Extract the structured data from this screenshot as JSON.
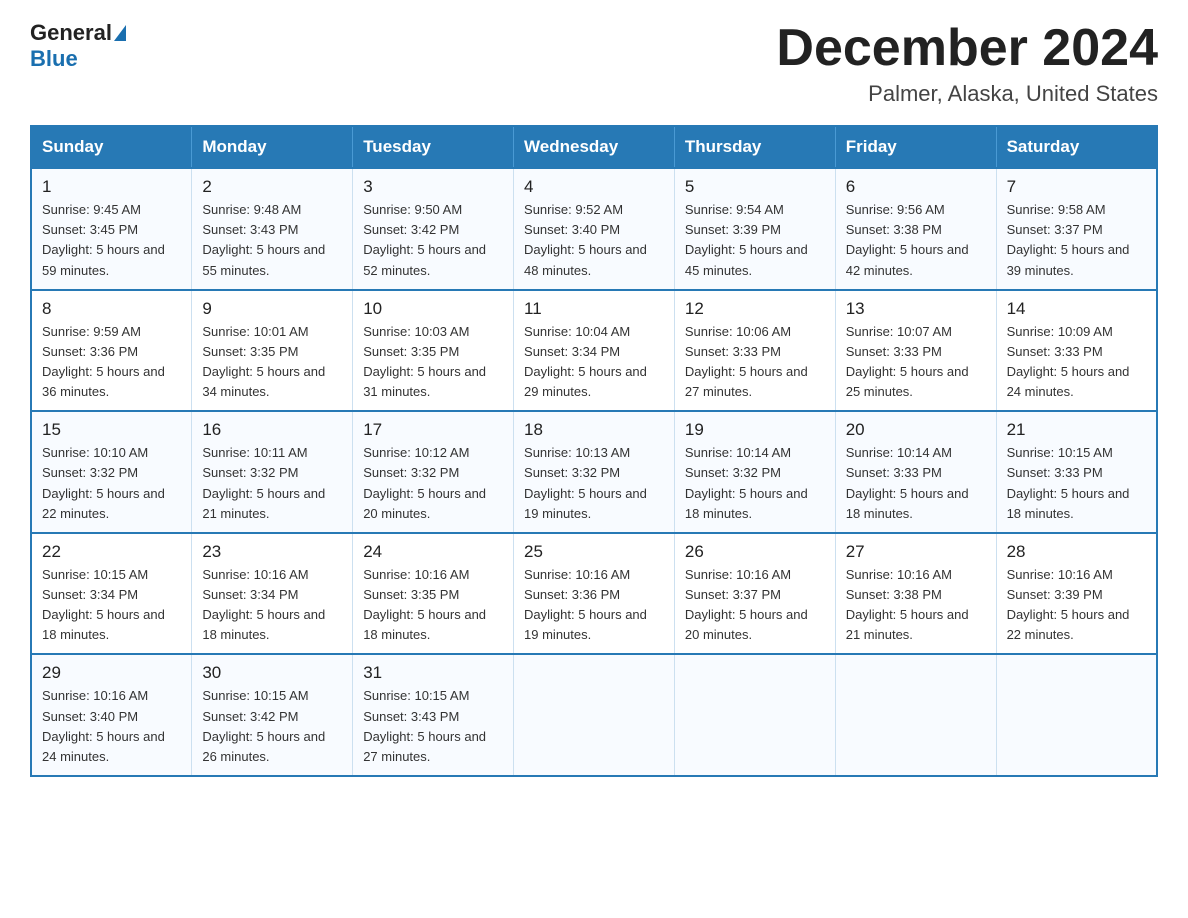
{
  "header": {
    "logo_general": "General",
    "logo_blue": "Blue",
    "month_title": "December 2024",
    "location": "Palmer, Alaska, United States"
  },
  "weekdays": [
    "Sunday",
    "Monday",
    "Tuesday",
    "Wednesday",
    "Thursday",
    "Friday",
    "Saturday"
  ],
  "weeks": [
    [
      {
        "day": "1",
        "sunrise": "9:45 AM",
        "sunset": "3:45 PM",
        "daylight": "5 hours and 59 minutes."
      },
      {
        "day": "2",
        "sunrise": "9:48 AM",
        "sunset": "3:43 PM",
        "daylight": "5 hours and 55 minutes."
      },
      {
        "day": "3",
        "sunrise": "9:50 AM",
        "sunset": "3:42 PM",
        "daylight": "5 hours and 52 minutes."
      },
      {
        "day": "4",
        "sunrise": "9:52 AM",
        "sunset": "3:40 PM",
        "daylight": "5 hours and 48 minutes."
      },
      {
        "day": "5",
        "sunrise": "9:54 AM",
        "sunset": "3:39 PM",
        "daylight": "5 hours and 45 minutes."
      },
      {
        "day": "6",
        "sunrise": "9:56 AM",
        "sunset": "3:38 PM",
        "daylight": "5 hours and 42 minutes."
      },
      {
        "day": "7",
        "sunrise": "9:58 AM",
        "sunset": "3:37 PM",
        "daylight": "5 hours and 39 minutes."
      }
    ],
    [
      {
        "day": "8",
        "sunrise": "9:59 AM",
        "sunset": "3:36 PM",
        "daylight": "5 hours and 36 minutes."
      },
      {
        "day": "9",
        "sunrise": "10:01 AM",
        "sunset": "3:35 PM",
        "daylight": "5 hours and 34 minutes."
      },
      {
        "day": "10",
        "sunrise": "10:03 AM",
        "sunset": "3:35 PM",
        "daylight": "5 hours and 31 minutes."
      },
      {
        "day": "11",
        "sunrise": "10:04 AM",
        "sunset": "3:34 PM",
        "daylight": "5 hours and 29 minutes."
      },
      {
        "day": "12",
        "sunrise": "10:06 AM",
        "sunset": "3:33 PM",
        "daylight": "5 hours and 27 minutes."
      },
      {
        "day": "13",
        "sunrise": "10:07 AM",
        "sunset": "3:33 PM",
        "daylight": "5 hours and 25 minutes."
      },
      {
        "day": "14",
        "sunrise": "10:09 AM",
        "sunset": "3:33 PM",
        "daylight": "5 hours and 24 minutes."
      }
    ],
    [
      {
        "day": "15",
        "sunrise": "10:10 AM",
        "sunset": "3:32 PM",
        "daylight": "5 hours and 22 minutes."
      },
      {
        "day": "16",
        "sunrise": "10:11 AM",
        "sunset": "3:32 PM",
        "daylight": "5 hours and 21 minutes."
      },
      {
        "day": "17",
        "sunrise": "10:12 AM",
        "sunset": "3:32 PM",
        "daylight": "5 hours and 20 minutes."
      },
      {
        "day": "18",
        "sunrise": "10:13 AM",
        "sunset": "3:32 PM",
        "daylight": "5 hours and 19 minutes."
      },
      {
        "day": "19",
        "sunrise": "10:14 AM",
        "sunset": "3:32 PM",
        "daylight": "5 hours and 18 minutes."
      },
      {
        "day": "20",
        "sunrise": "10:14 AM",
        "sunset": "3:33 PM",
        "daylight": "5 hours and 18 minutes."
      },
      {
        "day": "21",
        "sunrise": "10:15 AM",
        "sunset": "3:33 PM",
        "daylight": "5 hours and 18 minutes."
      }
    ],
    [
      {
        "day": "22",
        "sunrise": "10:15 AM",
        "sunset": "3:34 PM",
        "daylight": "5 hours and 18 minutes."
      },
      {
        "day": "23",
        "sunrise": "10:16 AM",
        "sunset": "3:34 PM",
        "daylight": "5 hours and 18 minutes."
      },
      {
        "day": "24",
        "sunrise": "10:16 AM",
        "sunset": "3:35 PM",
        "daylight": "5 hours and 18 minutes."
      },
      {
        "day": "25",
        "sunrise": "10:16 AM",
        "sunset": "3:36 PM",
        "daylight": "5 hours and 19 minutes."
      },
      {
        "day": "26",
        "sunrise": "10:16 AM",
        "sunset": "3:37 PM",
        "daylight": "5 hours and 20 minutes."
      },
      {
        "day": "27",
        "sunrise": "10:16 AM",
        "sunset": "3:38 PM",
        "daylight": "5 hours and 21 minutes."
      },
      {
        "day": "28",
        "sunrise": "10:16 AM",
        "sunset": "3:39 PM",
        "daylight": "5 hours and 22 minutes."
      }
    ],
    [
      {
        "day": "29",
        "sunrise": "10:16 AM",
        "sunset": "3:40 PM",
        "daylight": "5 hours and 24 minutes."
      },
      {
        "day": "30",
        "sunrise": "10:15 AM",
        "sunset": "3:42 PM",
        "daylight": "5 hours and 26 minutes."
      },
      {
        "day": "31",
        "sunrise": "10:15 AM",
        "sunset": "3:43 PM",
        "daylight": "5 hours and 27 minutes."
      },
      {
        "day": "",
        "sunrise": "",
        "sunset": "",
        "daylight": ""
      },
      {
        "day": "",
        "sunrise": "",
        "sunset": "",
        "daylight": ""
      },
      {
        "day": "",
        "sunrise": "",
        "sunset": "",
        "daylight": ""
      },
      {
        "day": "",
        "sunrise": "",
        "sunset": "",
        "daylight": ""
      }
    ]
  ]
}
